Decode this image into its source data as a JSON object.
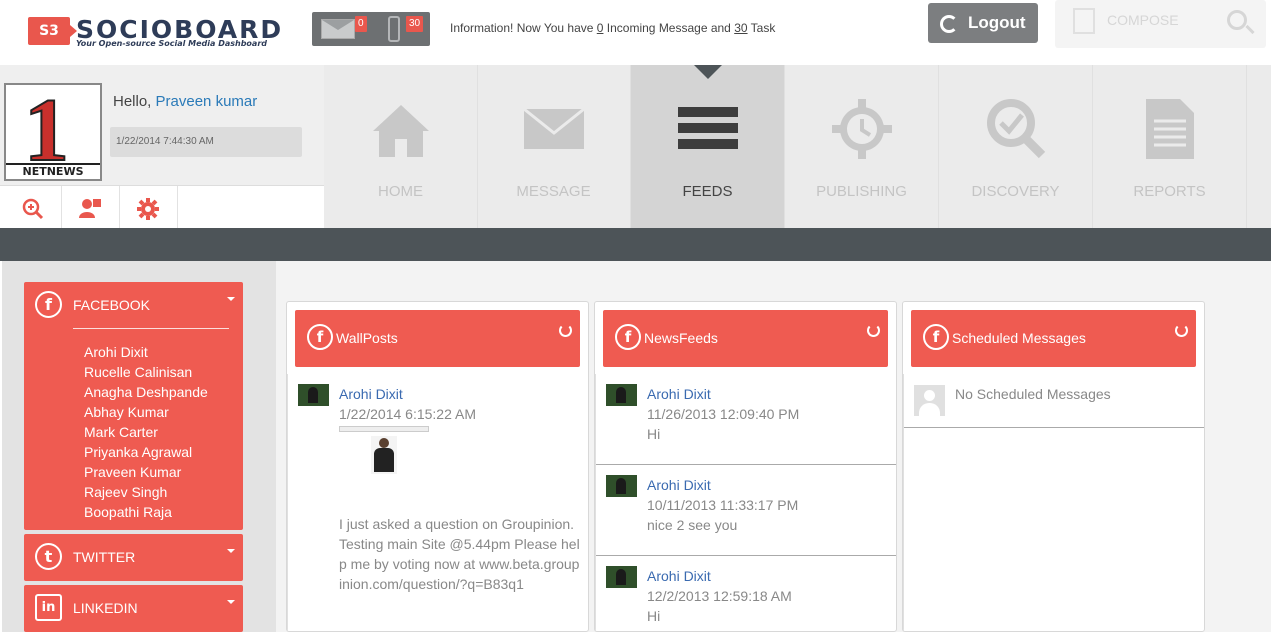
{
  "brand": {
    "badge": "S3",
    "name": "SOCIOBOARD",
    "tagline": "Your Open-source Social Media Dashboard"
  },
  "notifications": {
    "messages_count": "0",
    "tasks_count": "30",
    "info_prefix": "Information! Now You have ",
    "info_messages": "0",
    "info_middle": " Incoming Message and ",
    "info_tasks": "30",
    "info_suffix": " Task"
  },
  "header": {
    "logout_label": "Logout",
    "compose_label": "COMPOSE"
  },
  "profile": {
    "avatar_text": "1",
    "avatar_caption": "NETNEWS",
    "greeting": "Hello, ",
    "user_name": "Praveen kumar",
    "datetime": "1/22/2014 7:44:30 AM"
  },
  "nav": {
    "items": [
      {
        "label": "HOME",
        "icon": "home-icon"
      },
      {
        "label": "MESSAGE",
        "icon": "envelope-icon"
      },
      {
        "label": "FEEDS",
        "icon": "list-icon",
        "active": true
      },
      {
        "label": "PUBLISHING",
        "icon": "gear-clock-icon"
      },
      {
        "label": "DISCOVERY",
        "icon": "magnifier-check-icon"
      },
      {
        "label": "REPORTS",
        "icon": "document-icon"
      }
    ]
  },
  "sidebar": {
    "facebook": {
      "title": "FACEBOOK",
      "accounts": [
        "Arohi Dixit",
        "Rucelle Calinisan",
        "Anagha Deshpande",
        "Abhay Kumar",
        "Mark Carter",
        "Priyanka Agrawal",
        "Praveen Kumar",
        "Rajeev Singh",
        "Boopathi Raja"
      ]
    },
    "twitter": {
      "title": "TWITTER"
    },
    "linkedin": {
      "title": "LINKEDIN"
    }
  },
  "panels": {
    "wallposts": {
      "title": "WallPosts",
      "posts": [
        {
          "author": "Arohi Dixit",
          "time": "1/22/2014 6:15:22 AM",
          "message": "I just asked a question on Groupinion. Testing main Site @5.44pm Please help me by voting now at www.beta.groupinion.com/question/?q=B83q1"
        }
      ]
    },
    "newsfeeds": {
      "title": "NewsFeeds",
      "posts": [
        {
          "author": "Arohi Dixit",
          "time": "11/26/2013 12:09:40 PM",
          "message": "Hi"
        },
        {
          "author": "Arohi Dixit",
          "time": "10/11/2013 11:33:17 PM",
          "message": "nice 2 see you"
        },
        {
          "author": "Arohi Dixit",
          "time": "12/2/2013 12:59:18 AM",
          "message": "Hi"
        }
      ]
    },
    "scheduled": {
      "title": "Scheduled Messages",
      "empty_text": "No Scheduled Messages"
    }
  },
  "colors": {
    "accent": "#ef5b51",
    "dark_band": "#4d5458",
    "link": "#3a6ab0"
  }
}
